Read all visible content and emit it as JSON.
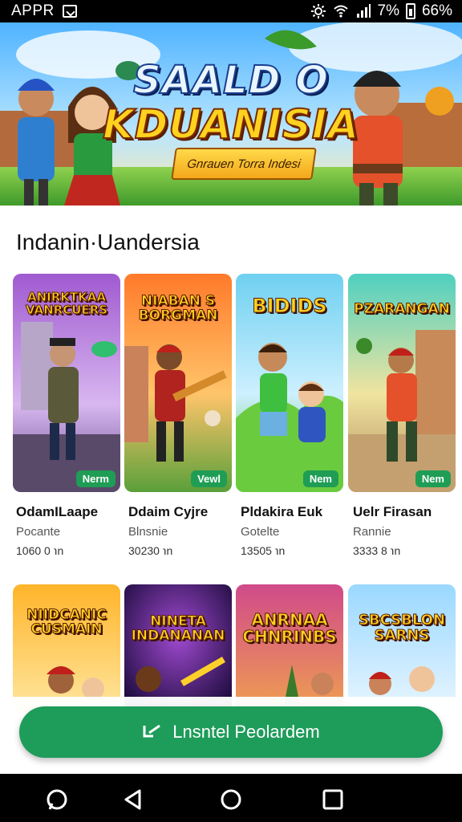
{
  "status_bar": {
    "left_label": "APPR",
    "battery_text": "66%",
    "signal_text": "7%"
  },
  "banner": {
    "title_line1": "SAALD O",
    "title_line2": "KDUANISIA",
    "subtitle": "Gnrauen Torra Indesi"
  },
  "section": {
    "title": "Indanin·Uandersia"
  },
  "games": [
    {
      "art_title": "ANIRKTKAA VANRCUERS",
      "badge": "Nerm",
      "name": "OdamILaape",
      "category": "Pocante",
      "stat": "1060 0 ℩n"
    },
    {
      "art_title": "NIABAN S BORGMAN",
      "badge": "Vewl",
      "name": "Ddaim Cyjre",
      "category": "Blnsnie",
      "stat": "30230 ℩n"
    },
    {
      "art_title": "BIDIDS",
      "badge": "Nem",
      "name": "Pldakira Euk",
      "category": "Gotelte",
      "stat": "13505 ℩n"
    },
    {
      "art_title": "PZARANGAN",
      "badge": "Nem",
      "name": "Uelr Firasan",
      "category": "Rannie",
      "stat": "3333 8 ℩n"
    }
  ],
  "games_row2": [
    {
      "art_title": "NIIDCANIC CUSMAIN"
    },
    {
      "art_title": "NINETA INDANANAN"
    },
    {
      "art_title": "ANRNAA CHNRINBS"
    },
    {
      "art_title": "SBCSBLON SARNS"
    }
  ],
  "install_button": {
    "label": "Lnsntel Peolardem"
  },
  "colors": {
    "accent": "#1e9c5a",
    "badge": "#1f9d55"
  }
}
